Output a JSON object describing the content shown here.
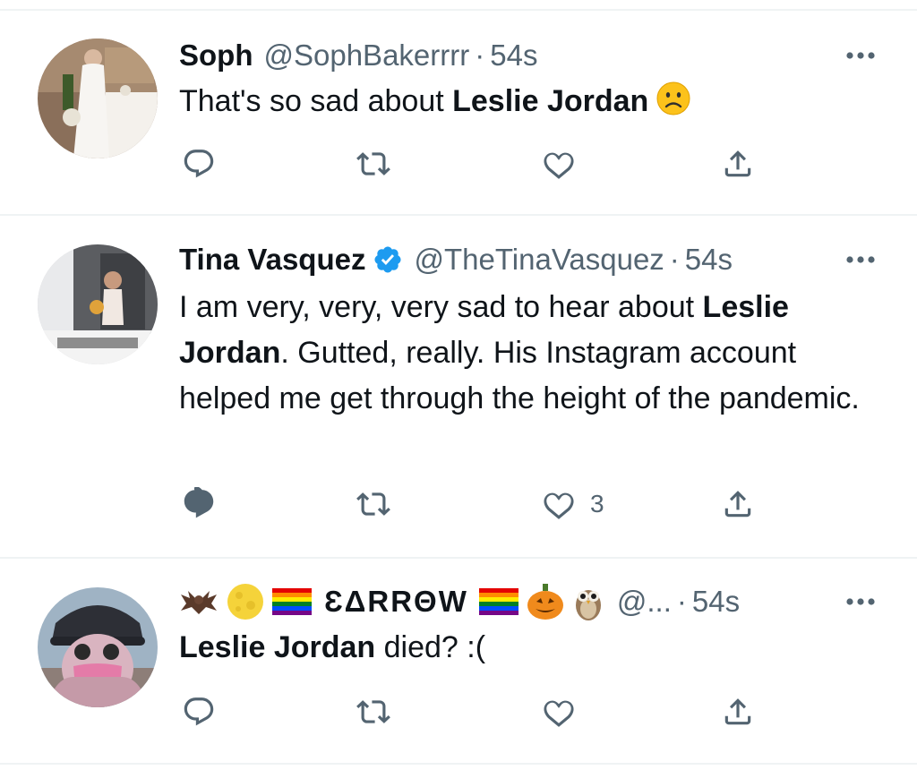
{
  "tweets": [
    {
      "name": "Soph",
      "handle": "@SophBakerrrr",
      "separator": "·",
      "time": "54s",
      "verified": false,
      "text_before": "That's so sad about ",
      "text_bold": "Leslie Jordan",
      "text_after": "",
      "emoji": "frowning-face",
      "likes": ""
    },
    {
      "name": "Tina Vasquez",
      "handle": "@TheTinaVasquez",
      "separator": "·",
      "time": "54s",
      "verified": true,
      "text_line1": "I am very, very, very sad to hear about ",
      "text_bold1": "Leslie",
      "text_bold2": "Jordan",
      "text_rest": ". Gutted, really. His Instagram account helped me get through the height of the pandemic.",
      "likes": "3"
    },
    {
      "name_prefix_emojis": [
        "bat",
        "full-moon",
        "rainbow-flag"
      ],
      "name": "ƐΔRRΘW",
      "name_suffix_emojis": [
        "rainbow-flag",
        "jack-o-lantern",
        "owl"
      ],
      "handle": "@...",
      "separator": "·",
      "time": "54s",
      "text_bold": "Leslie Jordan",
      "text_after": " died? :(",
      "likes": ""
    }
  ],
  "icons": [
    "reply-icon",
    "retweet-icon",
    "like-icon",
    "share-icon",
    "more-icon",
    "verified-badge-icon"
  ],
  "colors": {
    "text": "#0f1419",
    "secondary": "#536471",
    "verified": "#1d9bf0",
    "separator": "#eff3f4"
  }
}
